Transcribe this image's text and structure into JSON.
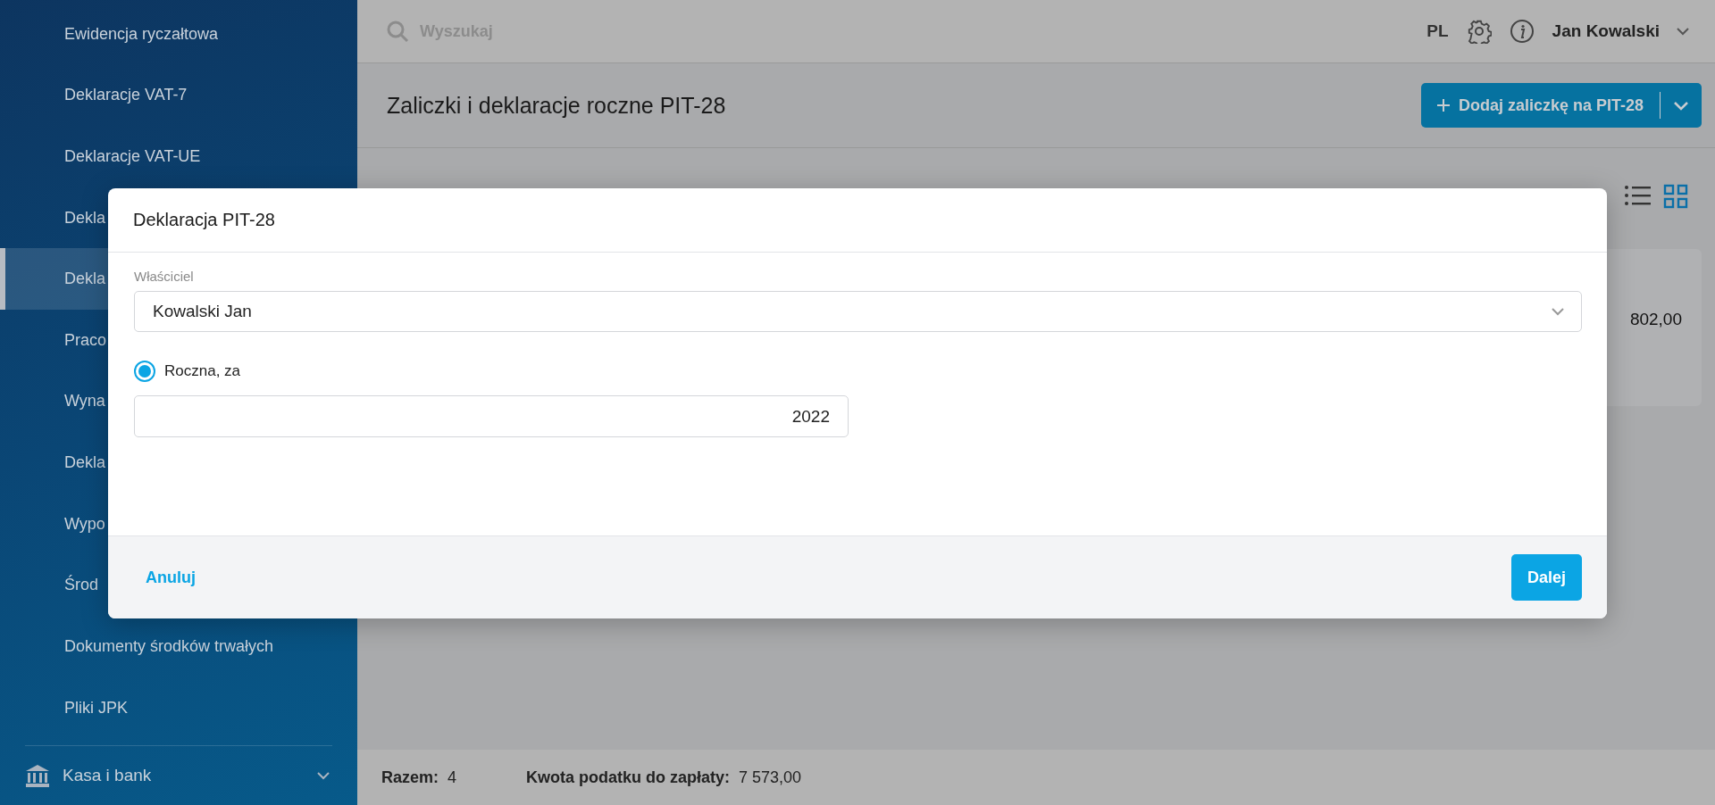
{
  "sidebar": {
    "items": [
      {
        "label": "Ewidencja ryczałtowa",
        "selected": false
      },
      {
        "label": "Deklaracje VAT-7",
        "selected": false
      },
      {
        "label": "Deklaracje VAT-UE",
        "selected": false
      },
      {
        "label": "Dekla",
        "selected": false
      },
      {
        "label": "Dekla",
        "selected": true
      },
      {
        "label": "Praco",
        "selected": false
      },
      {
        "label": "Wyna",
        "selected": false
      },
      {
        "label": "Dekla",
        "selected": false
      },
      {
        "label": "Wypo",
        "selected": false
      },
      {
        "label": "Środ",
        "selected": false
      },
      {
        "label": "Dokumenty środków trwałych",
        "selected": false
      },
      {
        "label": "Pliki JPK",
        "selected": false
      }
    ],
    "section": {
      "label": "Kasa i bank",
      "expanded": false
    }
  },
  "topbar": {
    "search": {
      "placeholder": "Wyszukaj"
    },
    "language": "PL",
    "user": "Jan Kowalski"
  },
  "page": {
    "title": "Zaliczki i deklaracje roczne PIT-28",
    "add_button": "Dodaj zaliczkę na PIT-28",
    "views": [
      {
        "kind": "list",
        "selected": false
      },
      {
        "kind": "grid",
        "selected": true
      }
    ],
    "card_amount": "802,00"
  },
  "dialog": {
    "title": "Deklaracja PIT-28",
    "owner": {
      "label": "Właściciel",
      "value": "Kowalski Jan"
    },
    "radio": {
      "label": "Roczna, za",
      "selected": true
    },
    "year": {
      "value": "2022"
    },
    "buttons": [
      {
        "kind": "cancel",
        "label": "Anuluj"
      },
      {
        "kind": "primary",
        "label": "Dalej"
      }
    ]
  },
  "footer": {
    "total_label": "Razem:",
    "total": "4",
    "tax_label": "Kwota podatku do zapłaty:",
    "tax": "7 573,00"
  }
}
